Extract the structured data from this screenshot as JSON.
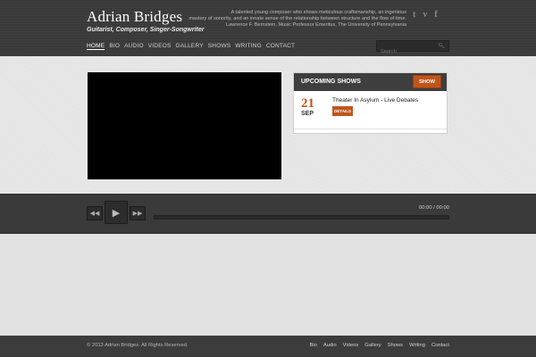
{
  "header": {
    "title": "Adrian Bridges",
    "tagline": "Guitarist, Composer, Singer-Songwriter",
    "quote_lines": [
      "A talented young composer who shows meticulous craftsmanship, an ingenious",
      "mastery of sonority, and an innate sense of the relationship between structure and the flow of time.",
      "Lawrence F. Bernstein, Music Professor Emeritus, The University of Pennsylvania"
    ],
    "social": [
      {
        "icon": "twitter-icon",
        "glyph": "t"
      },
      {
        "icon": "vimeo-icon",
        "glyph": "v"
      },
      {
        "icon": "facebook-icon",
        "glyph": "f"
      }
    ]
  },
  "nav": {
    "items": [
      "HOME",
      "BIO",
      "AUDIO",
      "VIDEOS",
      "GALLERY",
      "SHOWS",
      "WRITING",
      "CONTACT"
    ],
    "active": "HOME"
  },
  "search": {
    "placeholder": "Search"
  },
  "shows": {
    "title": "UPCOMING SHOWS",
    "show_all_label": "SHOW ALL",
    "events": [
      {
        "day": "21",
        "month": "SEP",
        "title": "Theater In Asylum - Live Debates",
        "details_label": "DETAILS"
      }
    ]
  },
  "player": {
    "time_current": "00:00",
    "time_separator": "/",
    "time_total": "00:00",
    "progress": 0
  },
  "footer": {
    "copyright": "© 2013 Adrian Bridges. All Rights Reserved.",
    "links": [
      "Bio",
      "Audio",
      "Videos",
      "Gallery",
      "Shows",
      "Writing",
      "Contact"
    ]
  },
  "colors": {
    "accent": "#c0551c",
    "header_bg": "#3a3a3a",
    "page_bg": "#e4e4e4"
  }
}
